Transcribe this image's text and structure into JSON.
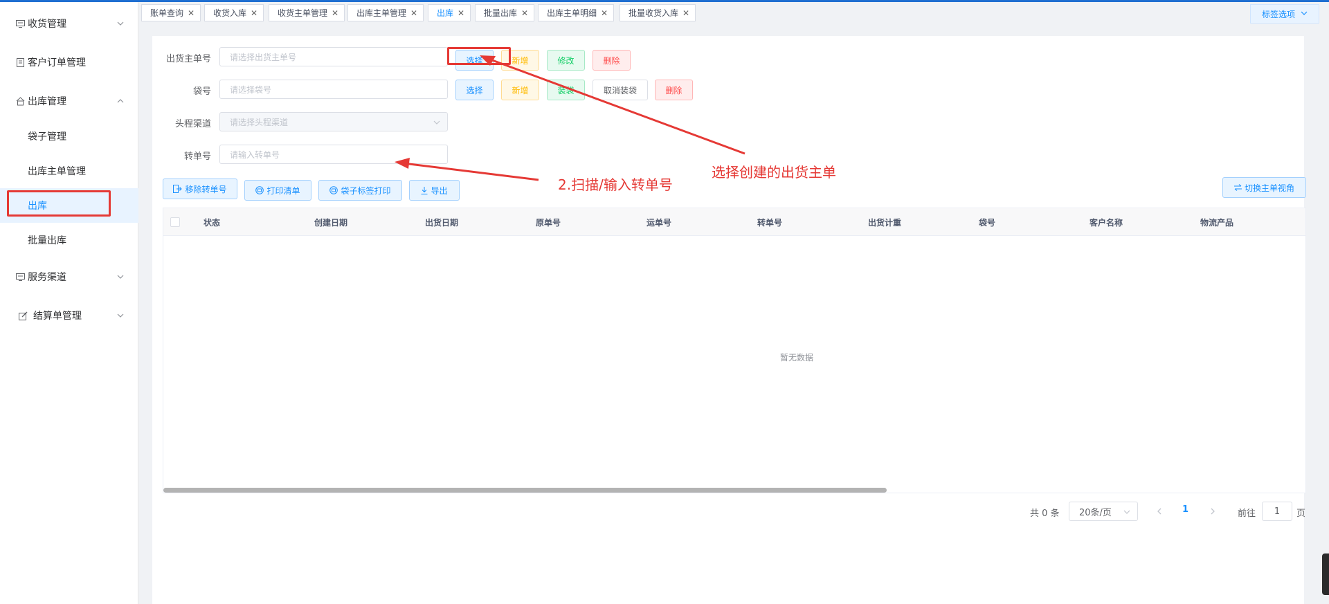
{
  "sidebar": {
    "items": [
      {
        "label": "收货管理",
        "icon": "receive-icon",
        "expanded": false
      },
      {
        "label": "客户订单管理",
        "icon": "document-icon"
      },
      {
        "label": "出库管理",
        "icon": "outbound-icon",
        "expanded": true
      },
      {
        "label": "服务渠道",
        "icon": "monitor-icon",
        "expanded": false
      },
      {
        "label": "结算单管理",
        "icon": "edit-icon",
        "expanded": false
      }
    ],
    "sub_items": [
      "袋子管理",
      "出库主单管理",
      "出库",
      "批量出库"
    ],
    "active_sub": "出库"
  },
  "tabs": {
    "items": [
      "账单查询",
      "收货入库",
      "收货主单管理",
      "出库主单管理",
      "出库",
      "批量出库",
      "出库主单明细",
      "批量收货入库"
    ],
    "active": "出库",
    "options_label": "标签选项"
  },
  "form": {
    "master_no": {
      "label": "出货主单号",
      "placeholder": "请选择出货主单号"
    },
    "bag_no": {
      "label": "袋号",
      "placeholder": "请选择袋号"
    },
    "channel": {
      "label": "头程渠道",
      "placeholder": "请选择头程渠道"
    },
    "transfer_no": {
      "label": "转单号",
      "placeholder": "请输入转单号"
    },
    "row1_buttons": {
      "select": "选择",
      "add": "新增",
      "edit": "修改",
      "delete": "删除"
    },
    "row2_buttons": {
      "select": "选择",
      "add": "新增",
      "pack": "装袋",
      "cancel_pack": "取消装袋",
      "delete": "删除"
    }
  },
  "toolbar": {
    "remove_transfer": "移除转单号",
    "print_list": "打印清单",
    "print_bag_label": "袋子标签打印",
    "export": "导出",
    "switch_view": "切换主单视角"
  },
  "table": {
    "columns": [
      "状态",
      "创建日期",
      "出货日期",
      "原单号",
      "运单号",
      "转单号",
      "出货计重",
      "袋号",
      "客户名称",
      "物流产品"
    ],
    "empty_text": "暂无数据"
  },
  "pagination": {
    "total": "共 0 条",
    "page_size": "20条/页",
    "current_page": "1",
    "goto_prefix": "前往",
    "goto_value": "1",
    "goto_suffix": "页"
  },
  "annotations": {
    "select_master": "选择创建的出货主单",
    "scan_input": "2.扫描/输入转单号",
    "color": "#e53935"
  }
}
